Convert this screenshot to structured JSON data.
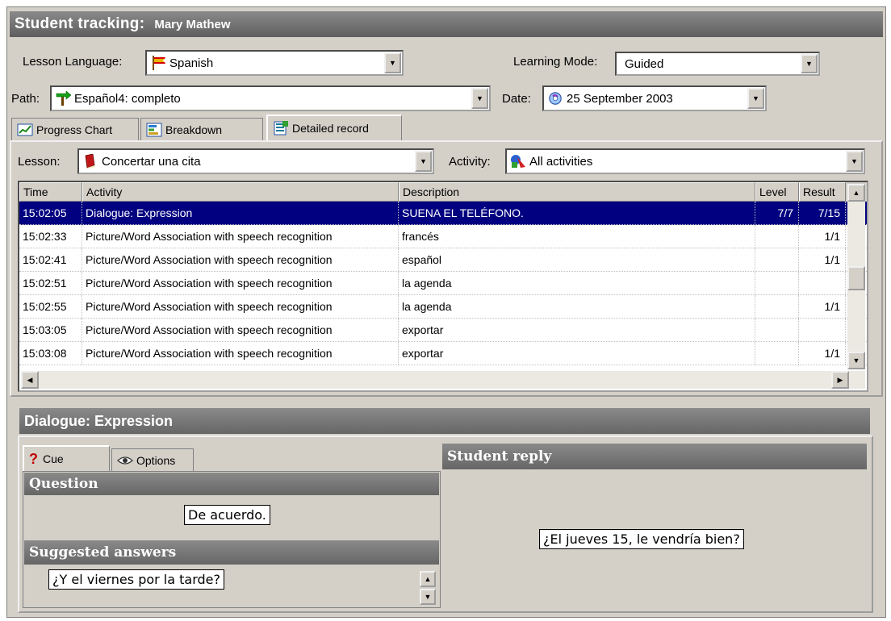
{
  "window": {
    "title": "Student tracking:",
    "student_name": "Mary Mathew"
  },
  "controls": {
    "lesson_language_label": "Lesson Language:",
    "lesson_language_value": "Spanish",
    "learning_mode_label": "Learning Mode:",
    "learning_mode_value": "Guided",
    "path_label": "Path:",
    "path_value": "Español4: completo",
    "date_label": "Date:",
    "date_value": "25 September 2003"
  },
  "tabs": [
    {
      "label": "Progress Chart"
    },
    {
      "label": "Breakdown"
    },
    {
      "label": "Detailed record"
    }
  ],
  "filters": {
    "lesson_label": "Lesson:",
    "lesson_value": "Concertar una cita",
    "activity_label": "Activity:",
    "activity_value": "All activities"
  },
  "table": {
    "columns": [
      "Time",
      "Activity",
      "Description",
      "Level",
      "Result"
    ],
    "rows": [
      {
        "time": "15:02:05",
        "activity": "Dialogue: Expression",
        "description": "SUENA EL TELÉFONO.",
        "level": "7/7",
        "result": "7/15"
      },
      {
        "time": "15:02:33",
        "activity": "Picture/Word Association with speech recognition",
        "description": "francés",
        "level": "",
        "result": "1/1"
      },
      {
        "time": "15:02:41",
        "activity": "Picture/Word Association with speech recognition",
        "description": "español",
        "level": "",
        "result": "1/1"
      },
      {
        "time": "15:02:51",
        "activity": "Picture/Word Association with speech recognition",
        "description": "la agenda",
        "level": "",
        "result": ""
      },
      {
        "time": "15:02:55",
        "activity": "Picture/Word Association with speech recognition",
        "description": "la agenda",
        "level": "",
        "result": "1/1"
      },
      {
        "time": "15:03:05",
        "activity": "Picture/Word Association with speech recognition",
        "description": "exportar",
        "level": "",
        "result": ""
      },
      {
        "time": "15:03:08",
        "activity": "Picture/Word Association with speech recognition",
        "description": "exportar",
        "level": "",
        "result": "1/1"
      }
    ]
  },
  "detail": {
    "title": "Dialogue: Expression",
    "cue_tab": "Cue",
    "options_tab": "Options",
    "question_header": "Question",
    "question_text": "De acuerdo.",
    "suggested_header": "Suggested answers",
    "suggested_answers": [
      "¿Y el viernes por la tarde?"
    ],
    "student_reply_header": "Student reply",
    "student_reply_text": "¿El jueves 15, le vendría bien?"
  },
  "colors": {
    "selection": "#000080",
    "titlebar": "#6e6e6e",
    "face": "#d4d0c8"
  }
}
